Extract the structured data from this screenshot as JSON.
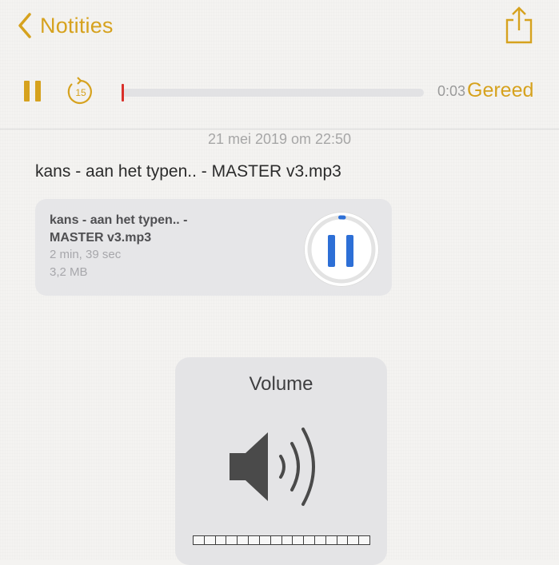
{
  "nav": {
    "back_label": "Notities"
  },
  "player": {
    "skip_seconds": "15",
    "time": "0:03",
    "done_label": "Gereed",
    "progress": 0.0
  },
  "note": {
    "date": "21 mei 2019 om 22:50",
    "title": "kans - aan het typen.. - MASTER v3.mp3"
  },
  "attachment": {
    "name_line1": "kans - aan het typen.. -",
    "name_line2": "MASTER v3.mp3",
    "duration": "2 min, 39 sec",
    "size": "3,2 MB",
    "playback_progress": 0.02
  },
  "volume": {
    "title": "Volume",
    "segments": 16,
    "level": 0
  },
  "colors": {
    "accent": "#d6a21e",
    "blue": "#2d6fd6",
    "playhead": "#d9302a"
  },
  "icons": [
    "chevron-left-icon",
    "share-icon",
    "pause-icon",
    "skip-back-15-icon",
    "speaker-icon"
  ]
}
